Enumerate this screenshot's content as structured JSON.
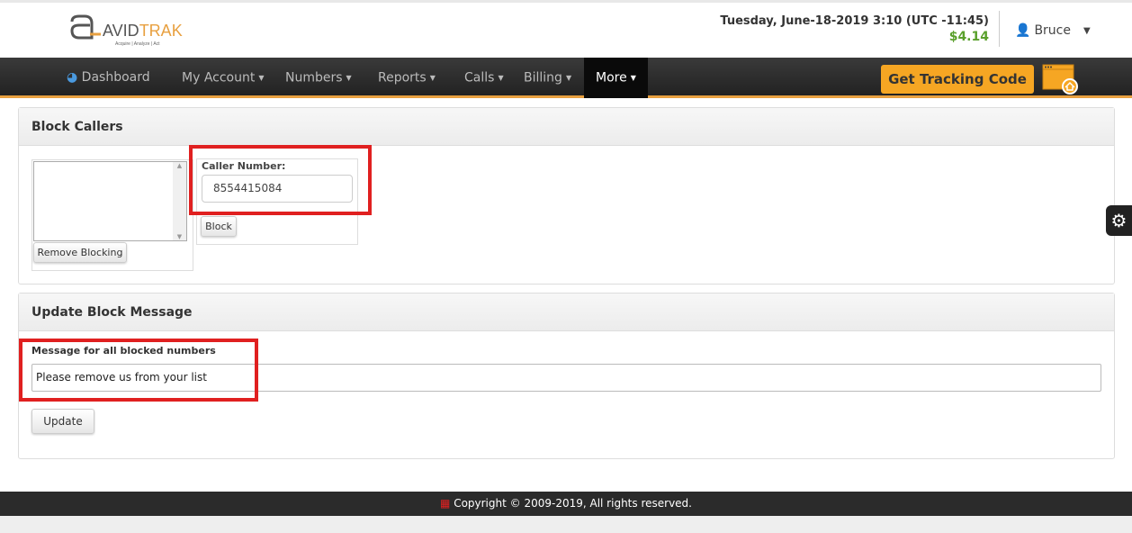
{
  "header": {
    "logo_text": "AVIDTRAK",
    "logo_tagline": "Acquire | Analyze | Act",
    "datetime": "Tuesday, June-18-2019 3:10 (UTC -11:45)",
    "balance": "$4.14",
    "user": "Bruce"
  },
  "nav": {
    "items": [
      {
        "label": "Dashboard"
      },
      {
        "label": "My Account"
      },
      {
        "label": "Numbers"
      },
      {
        "label": "Reports"
      },
      {
        "label": "Calls"
      },
      {
        "label": "Billing"
      },
      {
        "label": "More"
      }
    ],
    "tracking_button": "Get Tracking Code"
  },
  "block_callers": {
    "title": "Block Callers",
    "remove_button": "Remove Blocking",
    "caller_label": "Caller Number:",
    "caller_value": "8554415084",
    "block_button": "Block"
  },
  "block_message": {
    "title": "Update Block Message",
    "label": "Message for all blocked numbers",
    "value": "Please remove us from your list",
    "update_button": "Update"
  },
  "footer": {
    "copyright": "Copyright © 2009-2019, All rights reserved."
  },
  "colors": {
    "accent": "#f6a623",
    "balance": "#5aa02c",
    "highlight": "#e02020"
  }
}
